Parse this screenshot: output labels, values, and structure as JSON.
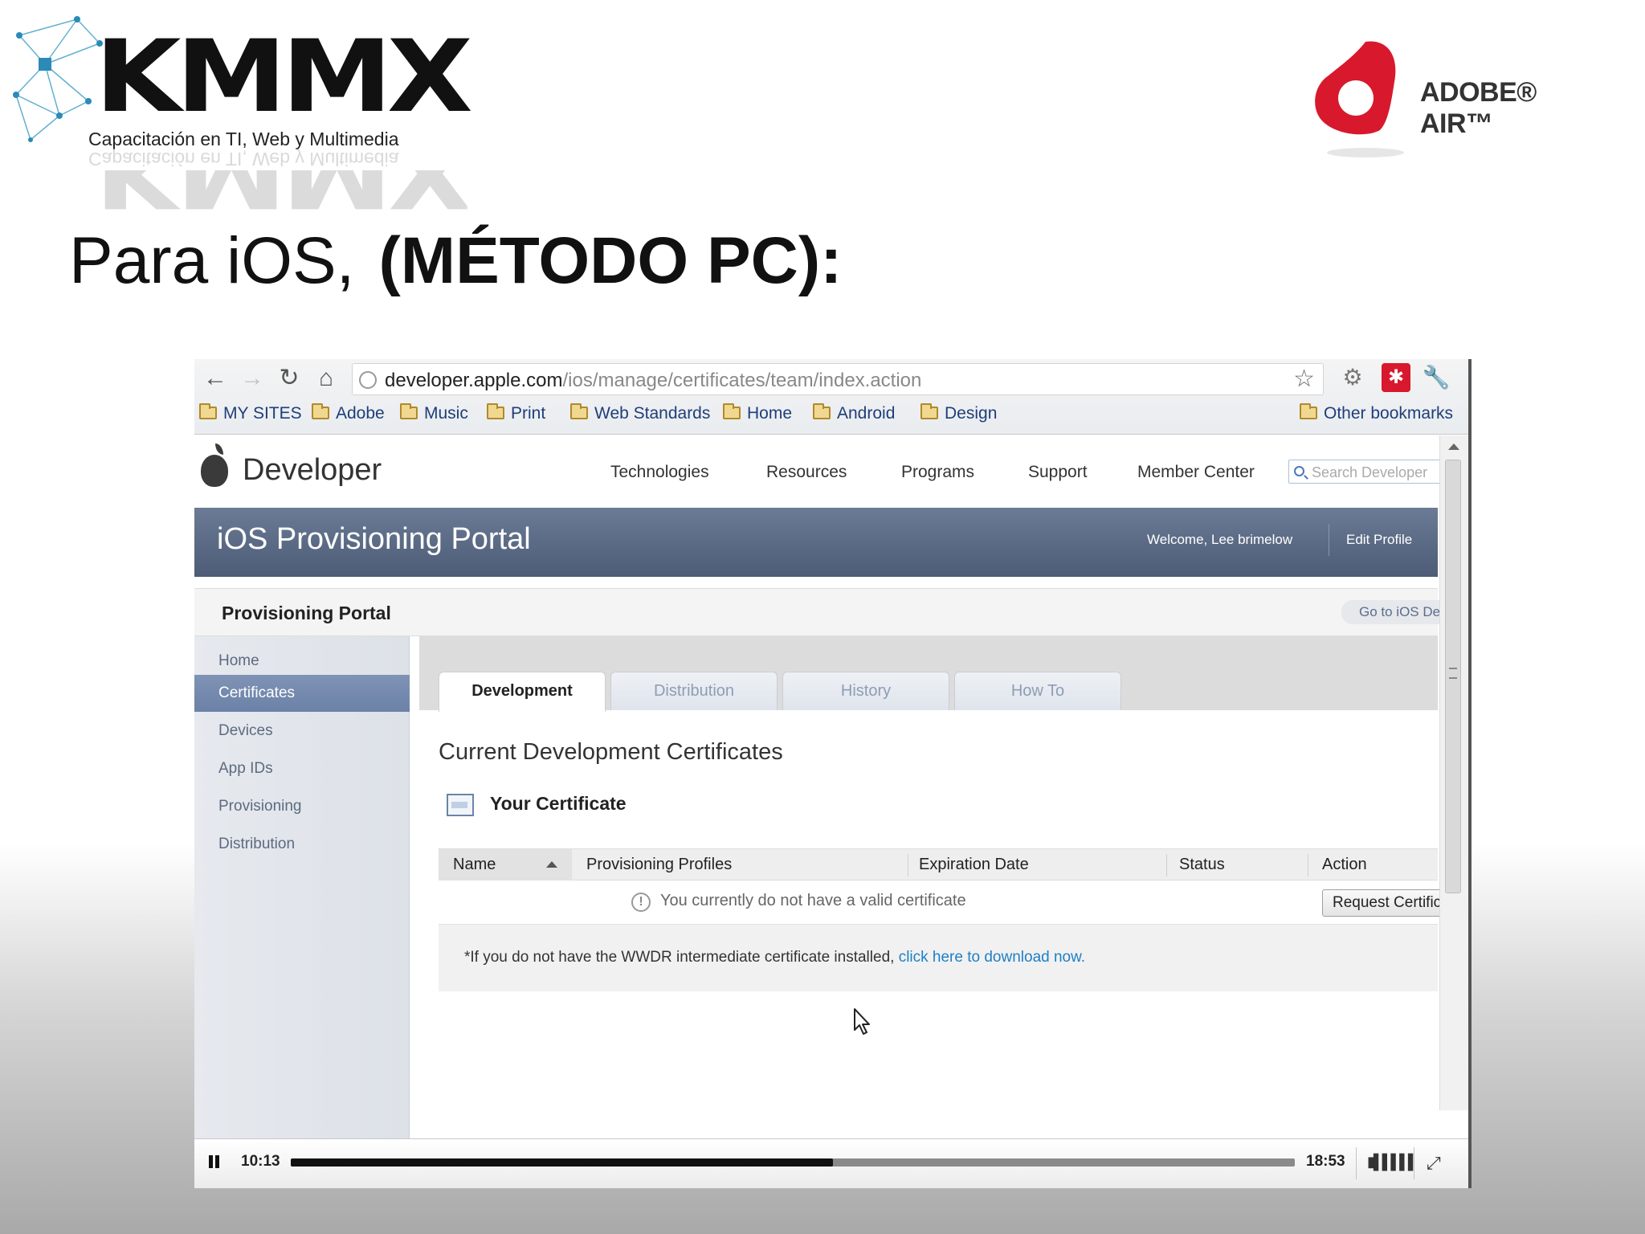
{
  "slide": {
    "brand_logo_text": "KMMX",
    "brand_tagline": "Capacitación en TI, Web y Multimedia",
    "partner_logo_text": "ADOBE® AIR™",
    "title_regular": "Para iOS,",
    "title_bold": "(MÉTODO PC):"
  },
  "browser": {
    "url_host": "developer.apple.com",
    "url_path": "/ios/manage/certificates/team/index.action",
    "bookmarks": [
      "MY SITES",
      "Adobe",
      "Music",
      "Print",
      "Web Standards",
      "Home",
      "Android",
      "Design"
    ],
    "other_bookmarks": "Other bookmarks"
  },
  "site": {
    "brand": "Developer",
    "nav": [
      "Technologies",
      "Resources",
      "Programs",
      "Support",
      "Member Center"
    ],
    "search_placeholder": "Search Developer",
    "portal_title": "iOS Provisioning Portal",
    "welcome": "Welcome, Lee brimelow",
    "edit_profile": "Edit Profile",
    "section_title": "Provisioning Portal",
    "goto_ios": "Go to iOS Dev Center",
    "sidebar": [
      "Home",
      "Certificates",
      "Devices",
      "App IDs",
      "Provisioning",
      "Distribution"
    ],
    "sidebar_active_index": 1,
    "tabs": [
      "Development",
      "Distribution",
      "History",
      "How To"
    ],
    "tab_active_index": 0,
    "content_title": "Current Development Certificates",
    "your_certificate": "Your Certificate",
    "table_headers": [
      "Name",
      "Provisioning Profiles",
      "Expiration Date",
      "Status",
      "Action"
    ],
    "empty_message": "You currently do not have a valid certificate",
    "request_button": "Request Certificate",
    "wwdr_text": "*If you do not have the WWDR intermediate certificate installed,",
    "wwdr_link": "click here to download now."
  },
  "player": {
    "current_time": "10:13",
    "total_time": "18:53",
    "progress": 0.54
  },
  "colors": {
    "portal_banner": "#5b6a85",
    "sidebar_active": "#7489ad",
    "link": "#1f7fc6",
    "brand_red": "#d8192d"
  }
}
